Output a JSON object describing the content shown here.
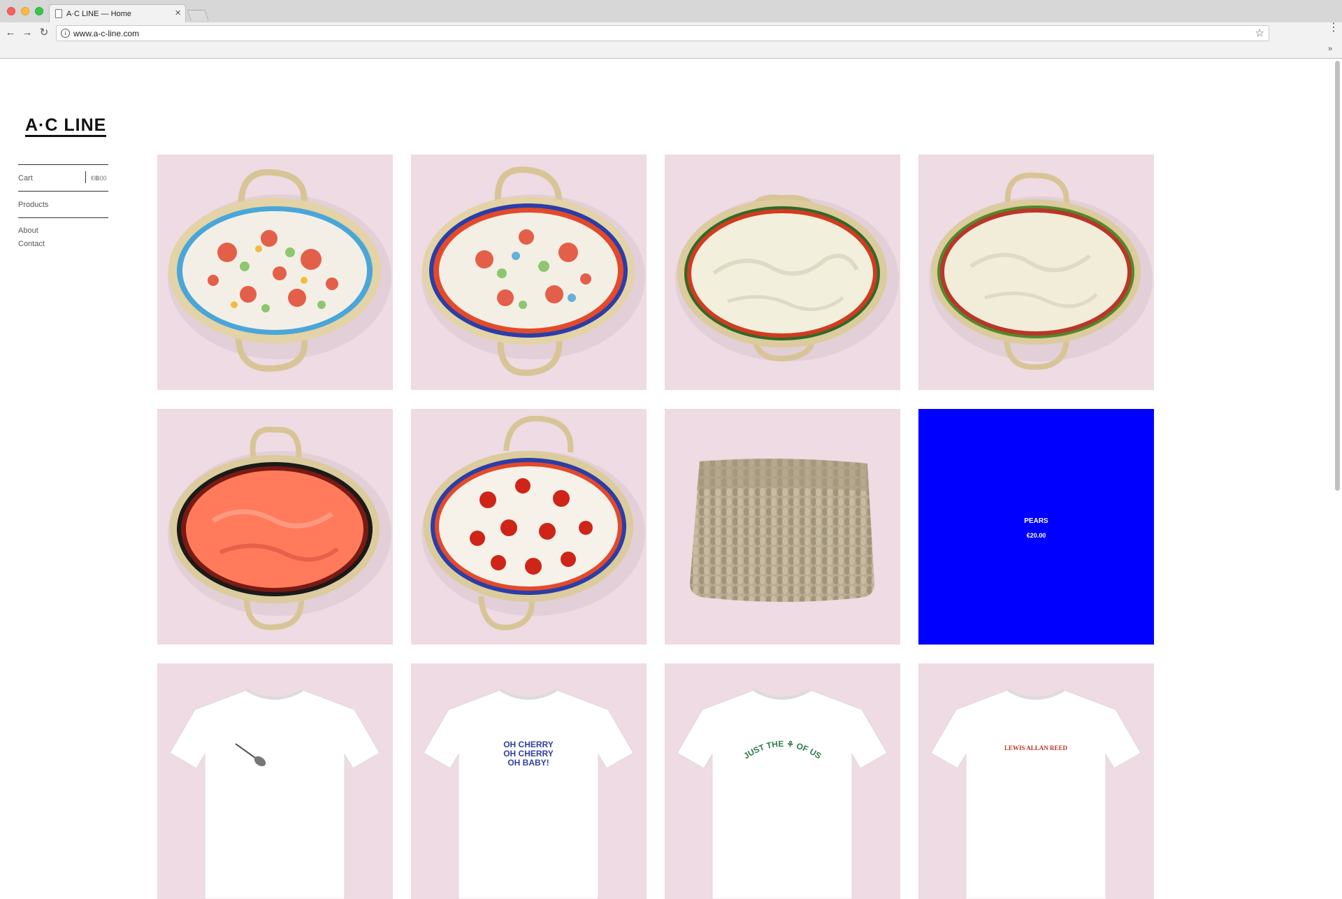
{
  "browser": {
    "tab_title": "A·C LINE — Home",
    "tab_close": "×",
    "url": "www.a-c-line.com",
    "nav": {
      "back": "←",
      "forward": "→",
      "reload": "↻"
    },
    "star": "☆",
    "menu": "⋮",
    "extensions": "»",
    "info": "i"
  },
  "site": {
    "logo": "A·C LINE",
    "cart": {
      "label": "Cart",
      "count": "0",
      "total": "€0.00"
    },
    "nav": {
      "products": "Products",
      "about": "About",
      "contact": "Contact"
    }
  },
  "products": [
    {
      "kind": "basket",
      "lining": "coral-floral"
    },
    {
      "kind": "basket",
      "lining": "coral-floral-blue-trim"
    },
    {
      "kind": "basket",
      "lining": "cream"
    },
    {
      "kind": "basket",
      "lining": "cream-green-trim"
    },
    {
      "kind": "basket",
      "lining": "coral"
    },
    {
      "kind": "basket",
      "lining": "red-flowers"
    },
    {
      "kind": "knit-pouch"
    },
    {
      "kind": "feature",
      "name": "PEARS",
      "price": "€20.00"
    },
    {
      "kind": "tshirt",
      "print": "spoon"
    },
    {
      "kind": "tshirt",
      "print_lines": [
        "OH CHERRY",
        "OH CHERRY",
        "OH BABY!"
      ]
    },
    {
      "kind": "tshirt",
      "print_text": "JUST THE ⚘ OF US"
    },
    {
      "kind": "tshirt",
      "print_text": "LEWIS ALLAN REED"
    }
  ],
  "colors": {
    "tile_background": "#eedbe3",
    "feature_background": "#0000ff"
  }
}
